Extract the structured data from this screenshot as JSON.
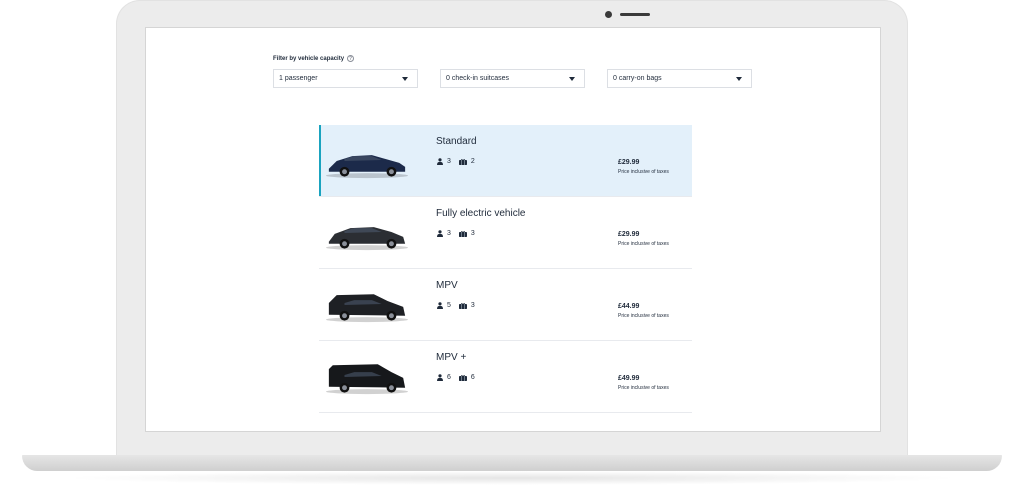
{
  "filter": {
    "title": "Filter by vehicle capacity",
    "help_icon": "?",
    "passengers": "1 passenger",
    "suitcases": "0 check-in suitcases",
    "carry_on": "0 carry-on bags"
  },
  "vehicles": [
    {
      "name": "Standard",
      "passengers": "3",
      "bags": "2",
      "price": "£29.99",
      "price_note": "Price inclusive of taxes",
      "selected": true,
      "color": "#1c2a4a"
    },
    {
      "name": "Fully electric vehicle",
      "passengers": "3",
      "bags": "3",
      "price": "£29.99",
      "price_note": "Price inclusive of taxes",
      "selected": false,
      "color": "#2b2e33"
    },
    {
      "name": "MPV",
      "passengers": "5",
      "bags": "3",
      "price": "£44.99",
      "price_note": "Price inclusive of taxes",
      "selected": false,
      "color": "#1e2024"
    },
    {
      "name": "MPV +",
      "passengers": "6",
      "bags": "6",
      "price": "£49.99",
      "price_note": "Price inclusive of taxes",
      "selected": false,
      "color": "#16181b"
    }
  ],
  "colors": {
    "accent": "#1aa3bf",
    "selected_bg": "#e3f0fa"
  }
}
